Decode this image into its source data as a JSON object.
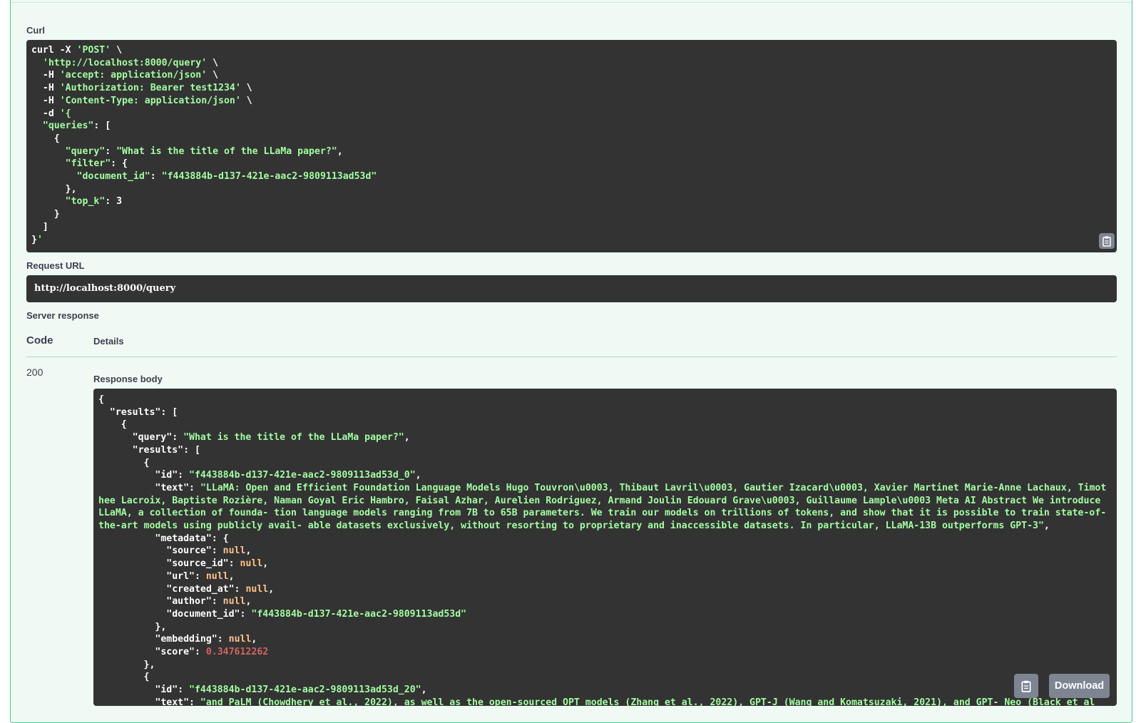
{
  "colors": {
    "panel_bg": "#effaf5",
    "panel_border": "#49cc90",
    "code_bg": "#333333",
    "string": "#a2fca2",
    "number": "#d36363",
    "null": "#fcc28c",
    "button_bg": "#7d8492"
  },
  "curl": {
    "label": "Curl",
    "lines": [
      "curl -X 'POST' \\",
      "  'http://localhost:8000/query' \\",
      "  -H 'accept: application/json' \\",
      "  -H 'Authorization: Bearer test1234' \\",
      "  -H 'Content-Type: application/json' \\",
      "  -d '{",
      "  \"queries\": [",
      "    {",
      "      \"query\": \"What is the title of the LLaMa paper?\",",
      "      \"filter\": {",
      "        \"document_id\": \"f443884b-d137-421e-aac2-9809113ad53d\"",
      "      },",
      "      \"top_k\": 3",
      "    }",
      "  ]",
      "}'"
    ],
    "copy_icon": "clipboard-icon"
  },
  "request_url": {
    "label": "Request URL",
    "value": "http://localhost:8000/query"
  },
  "server_response": {
    "label": "Server response",
    "col_code": "Code",
    "col_details": "Details",
    "code": "200",
    "body_label": "Response body",
    "body": {
      "l01": "{",
      "l02_key": "  \"results\"",
      "l02_rest": ": [",
      "l03": "    {",
      "l04_key": "      \"query\": ",
      "l04_val": "\"What is the title of the LLaMa paper?\"",
      "l04_end": ",",
      "l05": "      \"results\": [",
      "l06": "        {",
      "l07_key": "          \"id\": ",
      "l07_val": "\"f443884b-d137-421e-aac2-9809113ad53d_0\"",
      "l07_end": ",",
      "l08_key": "          \"text\": ",
      "l08_val": "\"LLaMA: Open and Efficient Foundation Language Models Hugo Touvron\\u0003, Thibaut Lavril\\u0003, Gautier Izacard\\u0003, Xavier Martinet Marie-Anne Lachaux, Timothee Lacroix, Baptiste Rozière, Naman Goyal Eric Hambro, Faisal Azhar, Aurelien Rodriguez, Armand Joulin Edouard Grave\\u0003, Guillaume Lample\\u0003 Meta AI Abstract We introduce LLaMA, a collection of founda- tion language models ranging from 7B to 65B parameters. We train our models on trillions of tokens, and show that it is possible to train state-of-the-art models using publicly avail- able datasets exclusively, without resorting to proprietary and inaccessible datasets. In particular, LLaMA-13B outperforms GPT-3\"",
      "l08_end": ",",
      "l09": "          \"metadata\": {",
      "l10_key": "            \"source\": ",
      "l11_key": "            \"source_id\": ",
      "l12_key": "            \"url\": ",
      "l13_key": "            \"created_at\": ",
      "l14_key": "            \"author\": ",
      "null_val": "null",
      "l15_key": "            \"document_id\": ",
      "l15_val": "\"f443884b-d137-421e-aac2-9809113ad53d\"",
      "l16": "          },",
      "l17_key": "          \"embedding\": ",
      "l18_key": "          \"score\": ",
      "l18_val": "0.347612262",
      "l19": "        },",
      "l20": "        {",
      "l21_key": "          \"id\": ",
      "l21_val": "\"f443884b-d137-421e-aac2-9809113ad53d_20\"",
      "l21_end": ",",
      "l22_key": "          \"text\": ",
      "l22_val": "\"and PaLM (Chowdhery et al., 2022), as well as the open-sourced OPT models (Zhang et al., 2022), GPT-J (Wang and Komatsuzaki, 2021), and GPT- Neo (Black et al"
    },
    "copy_icon": "clipboard-icon",
    "download_label": "Download"
  }
}
